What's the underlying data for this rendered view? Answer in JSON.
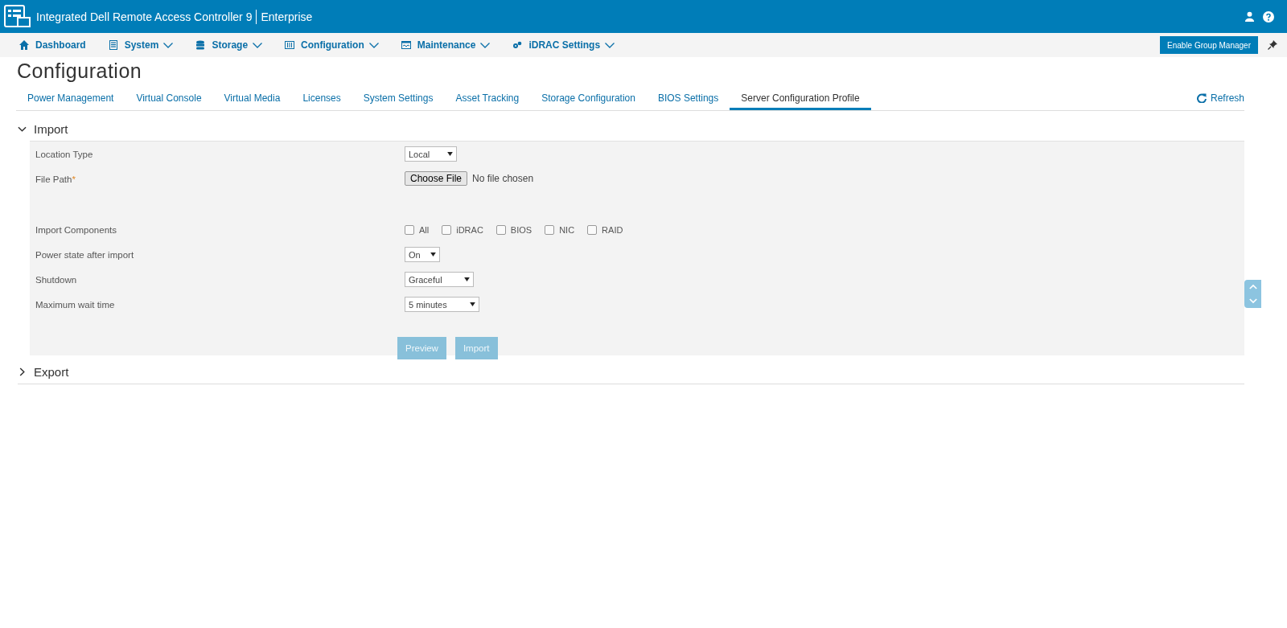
{
  "header": {
    "title": "Integrated Dell Remote Access Controller 9",
    "edition": "Enterprise"
  },
  "nav": {
    "items": [
      {
        "label": "Dashboard",
        "has_menu": false
      },
      {
        "label": "System",
        "has_menu": true
      },
      {
        "label": "Storage",
        "has_menu": true
      },
      {
        "label": "Configuration",
        "has_menu": true
      },
      {
        "label": "Maintenance",
        "has_menu": true
      },
      {
        "label": "iDRAC Settings",
        "has_menu": true
      }
    ],
    "group_button": "Enable Group Manager"
  },
  "page_title": "Configuration",
  "tabs": [
    {
      "label": "Power Management",
      "selected": false
    },
    {
      "label": "Virtual Console",
      "selected": false
    },
    {
      "label": "Virtual Media",
      "selected": false
    },
    {
      "label": "Licenses",
      "selected": false
    },
    {
      "label": "System Settings",
      "selected": false
    },
    {
      "label": "Asset Tracking",
      "selected": false
    },
    {
      "label": "Storage Configuration",
      "selected": false
    },
    {
      "label": "BIOS Settings",
      "selected": false
    },
    {
      "label": "Server Configuration Profile",
      "selected": true
    }
  ],
  "refresh": "Refresh",
  "import": {
    "title": "Import",
    "expanded": true,
    "fields": [
      {
        "kind": "select",
        "label": "Location Type",
        "value": "Local"
      },
      {
        "kind": "file",
        "label": "File Path",
        "required_mark": "*",
        "button": "Choose File",
        "status": "No file chosen"
      },
      {
        "kind": "checkboxes",
        "label": "Import Components",
        "options": [
          {
            "label": "All",
            "checked": false
          },
          {
            "label": "iDRAC",
            "checked": false
          },
          {
            "label": "BIOS",
            "checked": false
          },
          {
            "label": "NIC",
            "checked": false
          },
          {
            "label": "RAID",
            "checked": false
          }
        ]
      },
      {
        "kind": "select",
        "label": "Power state after import",
        "value": "On"
      },
      {
        "kind": "select",
        "label": "Shutdown",
        "value": "Graceful"
      },
      {
        "kind": "select",
        "label": "Maximum wait time",
        "value": "5 minutes"
      }
    ],
    "buttons": [
      {
        "label": "Preview",
        "disabled": true
      },
      {
        "label": "Import",
        "disabled": true
      }
    ]
  },
  "export": {
    "title": "Export",
    "expanded": false
  }
}
